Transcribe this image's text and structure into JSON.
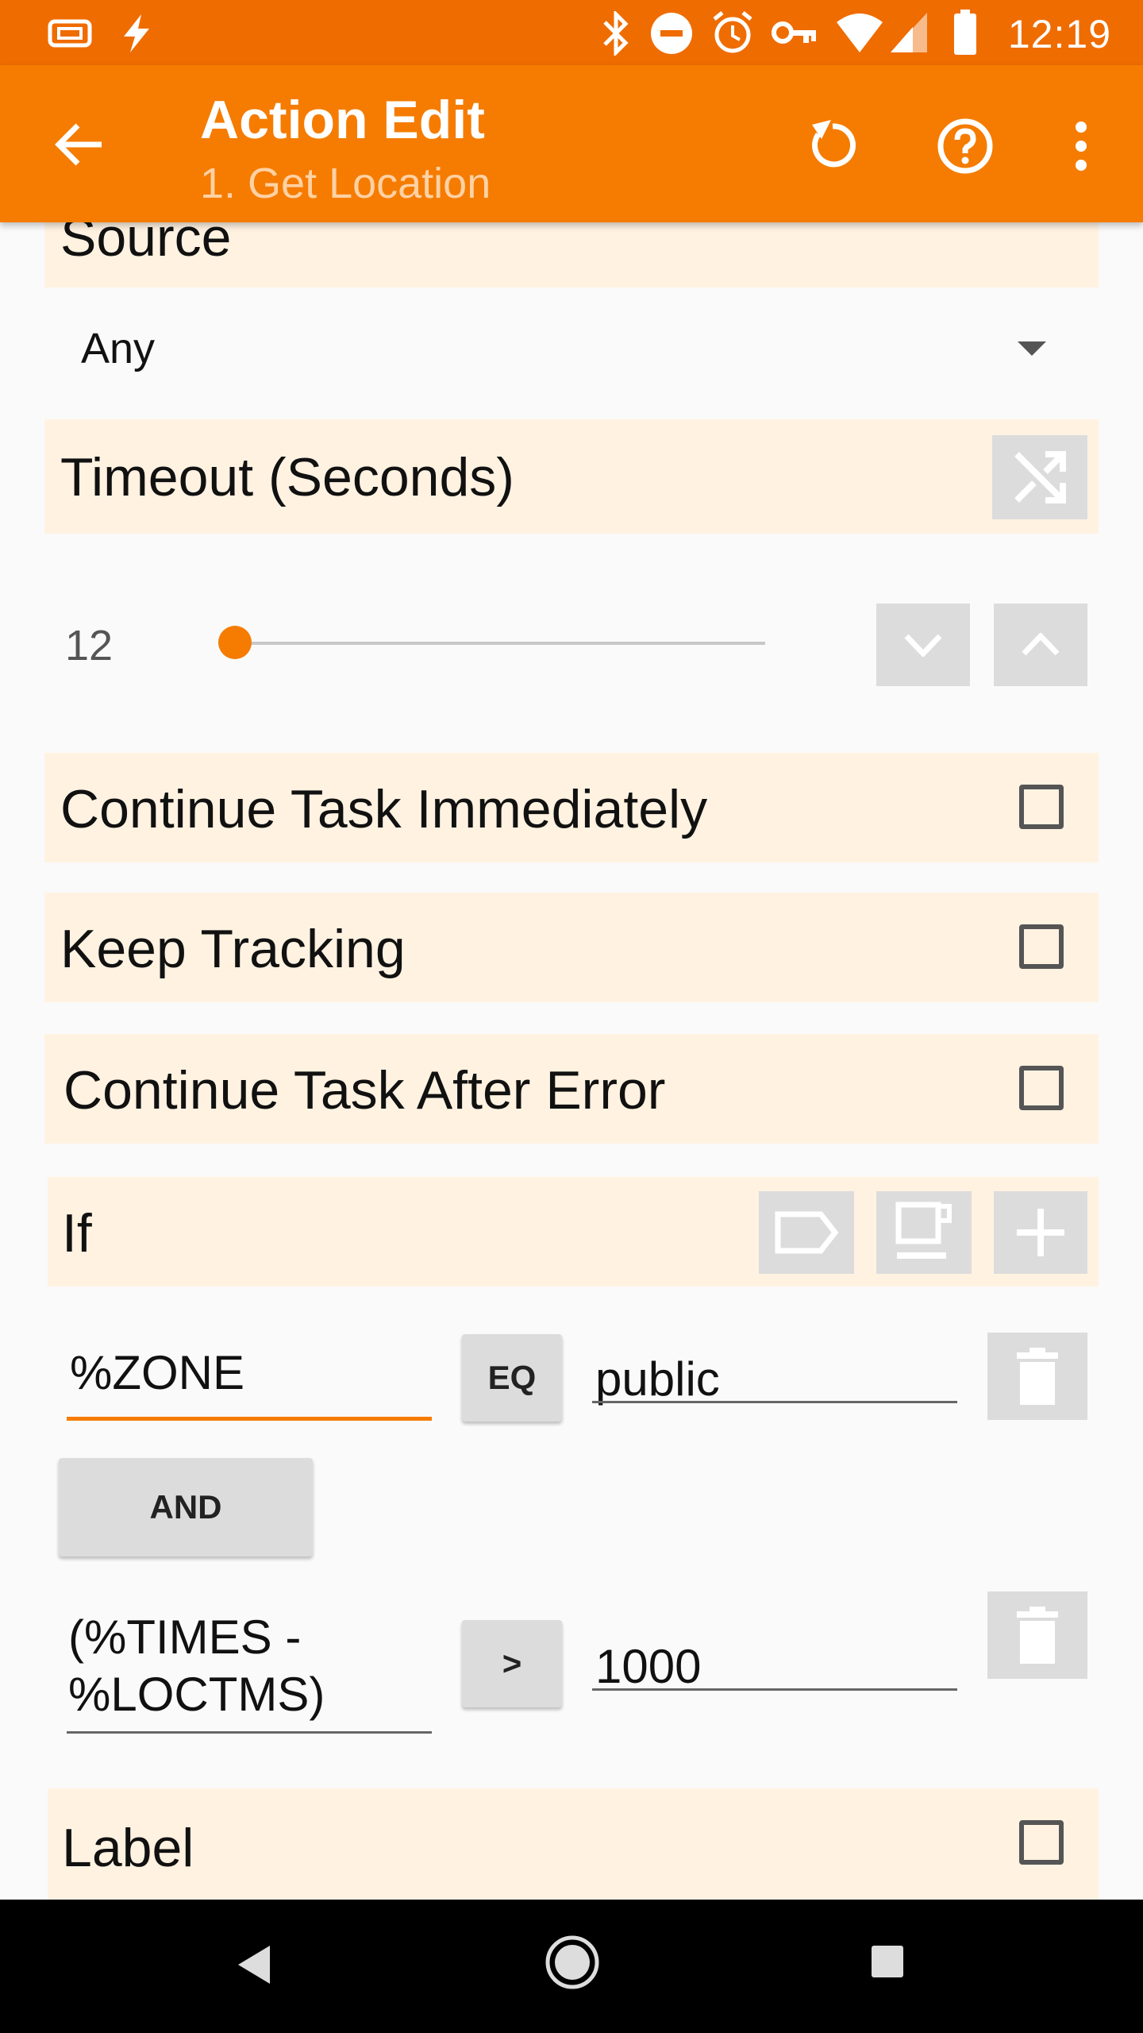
{
  "status_bar": {
    "time": "12:19",
    "icons": [
      "storage-icon",
      "flash-icon",
      "bluetooth-icon",
      "do-not-disturb-icon",
      "alarm-icon",
      "vpn-key-icon",
      "wifi-icon",
      "signal-icon",
      "battery-icon"
    ]
  },
  "app_bar": {
    "title": "Action Edit",
    "subtitle": "1. Get Location",
    "icons": [
      "back-arrow-icon",
      "reset-icon",
      "help-icon",
      "more-vert-icon"
    ]
  },
  "source": {
    "label": "Source",
    "selected": "Any"
  },
  "timeout": {
    "label": "Timeout (Seconds)",
    "value": "12",
    "slider_fraction": 0.0
  },
  "continue_immediately": {
    "label": "Continue Task Immediately",
    "checked": false
  },
  "keep_tracking": {
    "label": "Keep Tracking",
    "checked": false
  },
  "continue_after_error": {
    "label": "Continue Task After Error",
    "checked": false
  },
  "if_section": {
    "label": "If",
    "conditions": [
      {
        "left": "%ZONE",
        "op": "EQ",
        "right": "public"
      },
      {
        "left": "(%TIMES -\n%LOCTMS)",
        "op": ">",
        "right": "1000"
      }
    ],
    "join": "AND"
  },
  "label_section": {
    "label": "Label",
    "checked": false
  },
  "colors": {
    "accent": "#f57c00",
    "status": "#ef6c00",
    "section_bg": "#fff2e1",
    "button_grey": "#dcdcdc"
  }
}
